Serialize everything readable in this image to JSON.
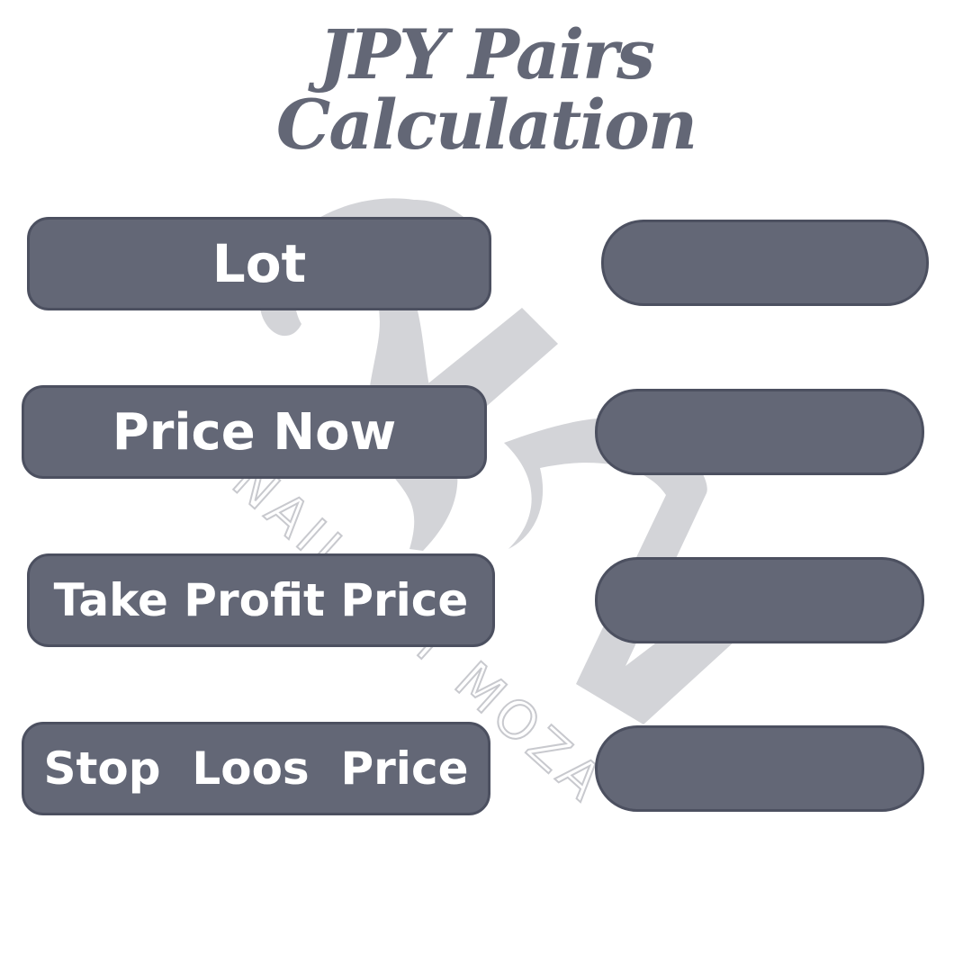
{
  "title": {
    "line1": "JPY Pairs",
    "line2": "Calculation"
  },
  "watermark": {
    "text": "NAILS BY MOZA"
  },
  "fields": [
    {
      "label": "Lot",
      "value": ""
    },
    {
      "label": "Price Now",
      "value": ""
    },
    {
      "label": "Take Profit Price",
      "value": ""
    },
    {
      "label": "Stop  Loos  Price",
      "value": ""
    }
  ],
  "colors": {
    "button_fill": "#636776",
    "title": "#636776",
    "watermark": "#d3d4d8"
  }
}
